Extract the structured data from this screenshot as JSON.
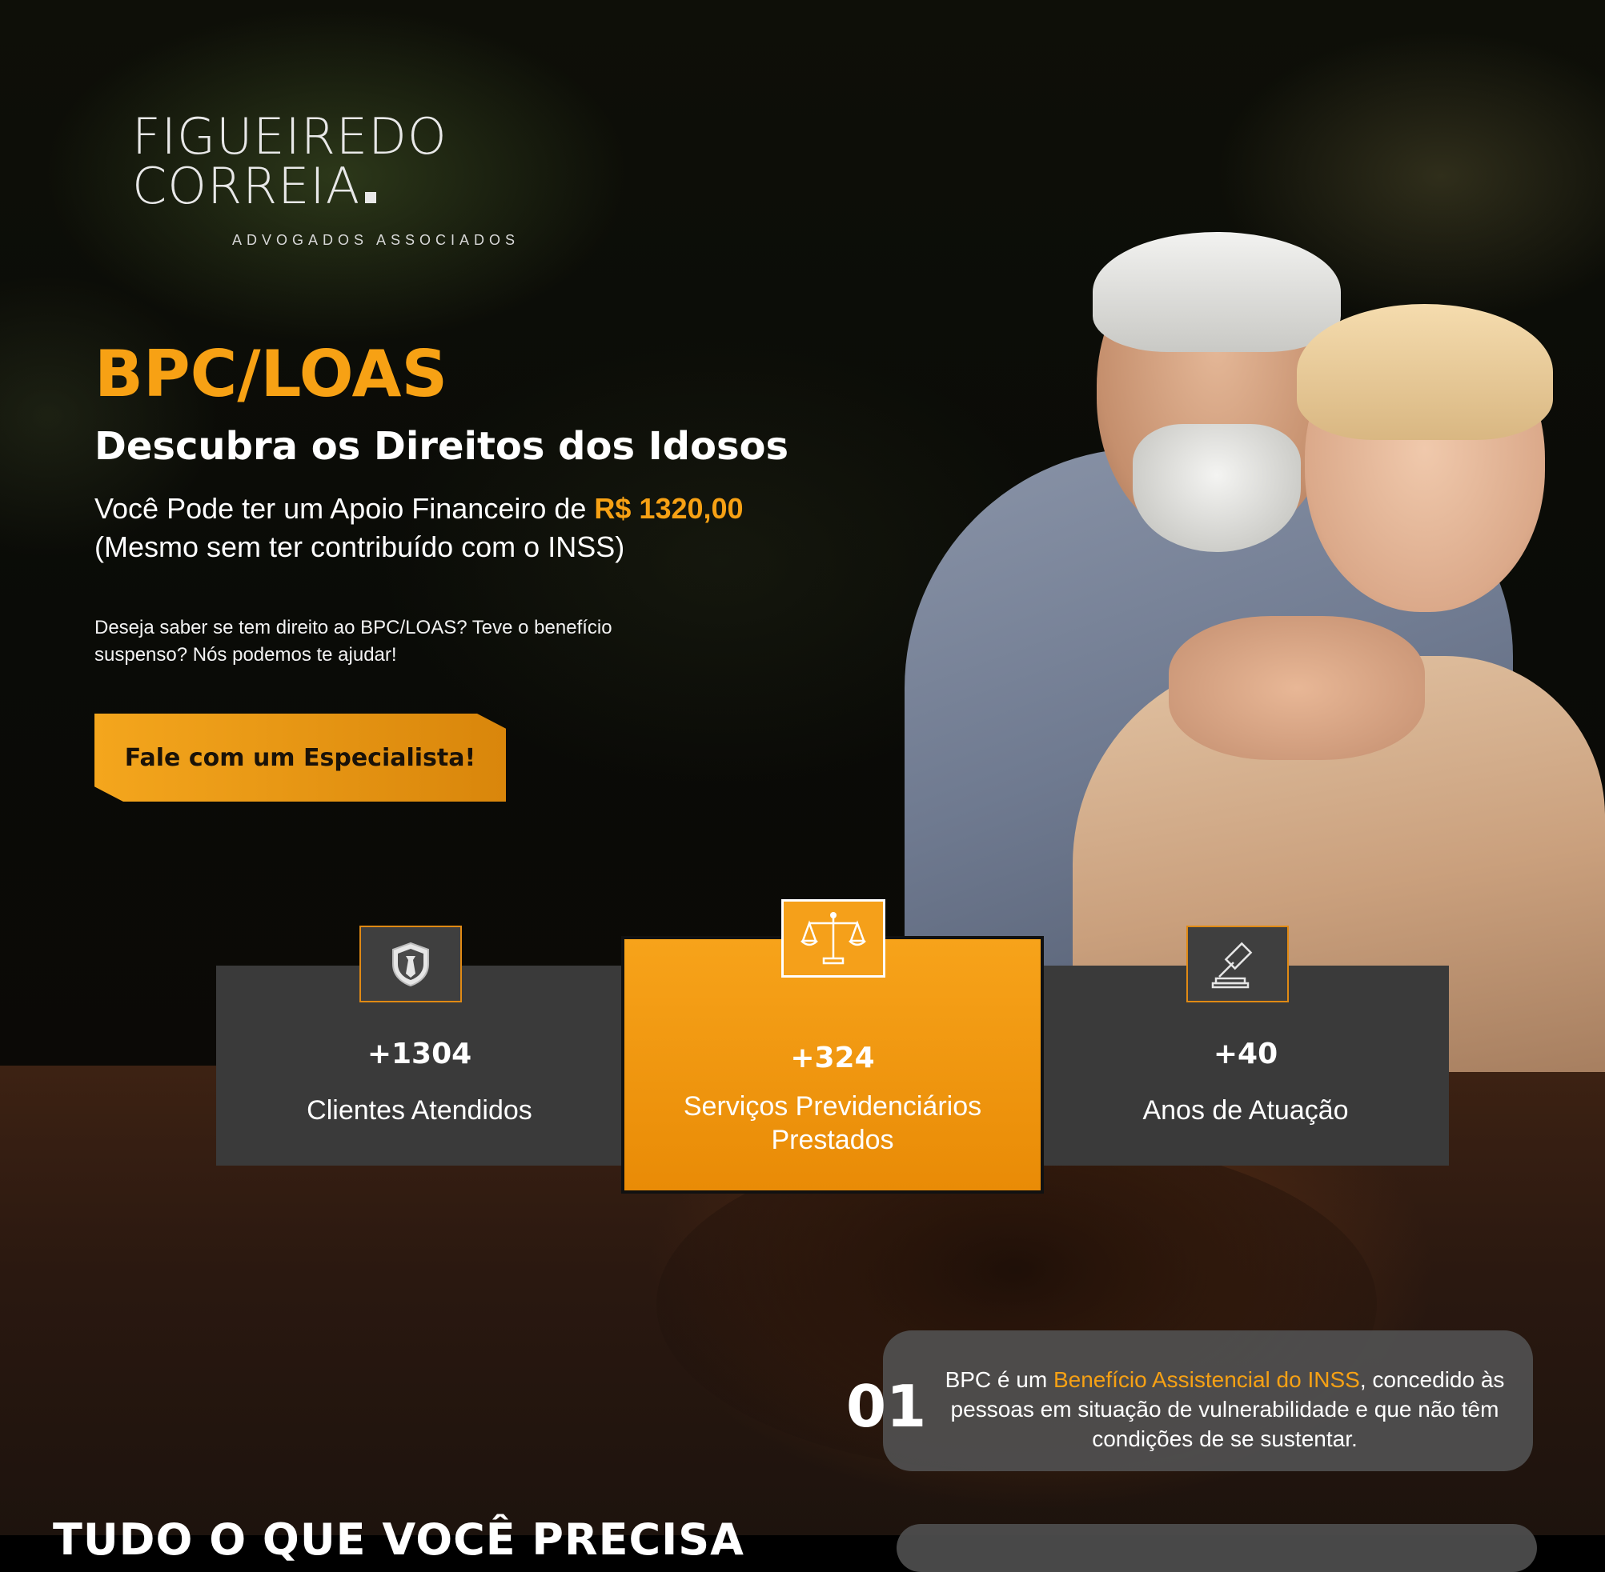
{
  "logo": {
    "name": "FIGUEIREDO CORREIA",
    "subtitle": "ADVOGADOS ASSOCIADOS"
  },
  "hero": {
    "title": "BPC/LOAS",
    "subtitle": "Descubra os Direitos dos Idosos",
    "offer_prefix": "Você Pode ter um Apoio Financeiro de ",
    "offer_amount": "R$ 1320,00",
    "offer_note": "(Mesmo sem ter contribuído com o INSS)",
    "description": "Deseja saber se tem direito ao BPC/LOAS? Teve o benefício suspenso? Nós podemos te ajudar!",
    "cta_label": "Fale com um Especialista!"
  },
  "stats": [
    {
      "value": "+1304",
      "label": "Clientes Atendidos",
      "icon": "shield-icon"
    },
    {
      "value": "+324",
      "label": "Serviços Previdenciários Prestados",
      "icon": "scales-icon"
    },
    {
      "value": "+40",
      "label": "Anos de Atuação",
      "icon": "gavel-icon"
    }
  ],
  "info": {
    "number": "01",
    "text_before": "BPC é um ",
    "text_highlight": "Benefício Assistencial do INSS",
    "text_after": ", concedido às pessoas em situação de vulnerabilidade e que não têm condições de se sustentar."
  },
  "section": {
    "title_partial": "TUDO O QUE VOCÊ PRECISA"
  },
  "colors": {
    "accent": "#f7a114",
    "card_dark": "#3a3a3a"
  }
}
